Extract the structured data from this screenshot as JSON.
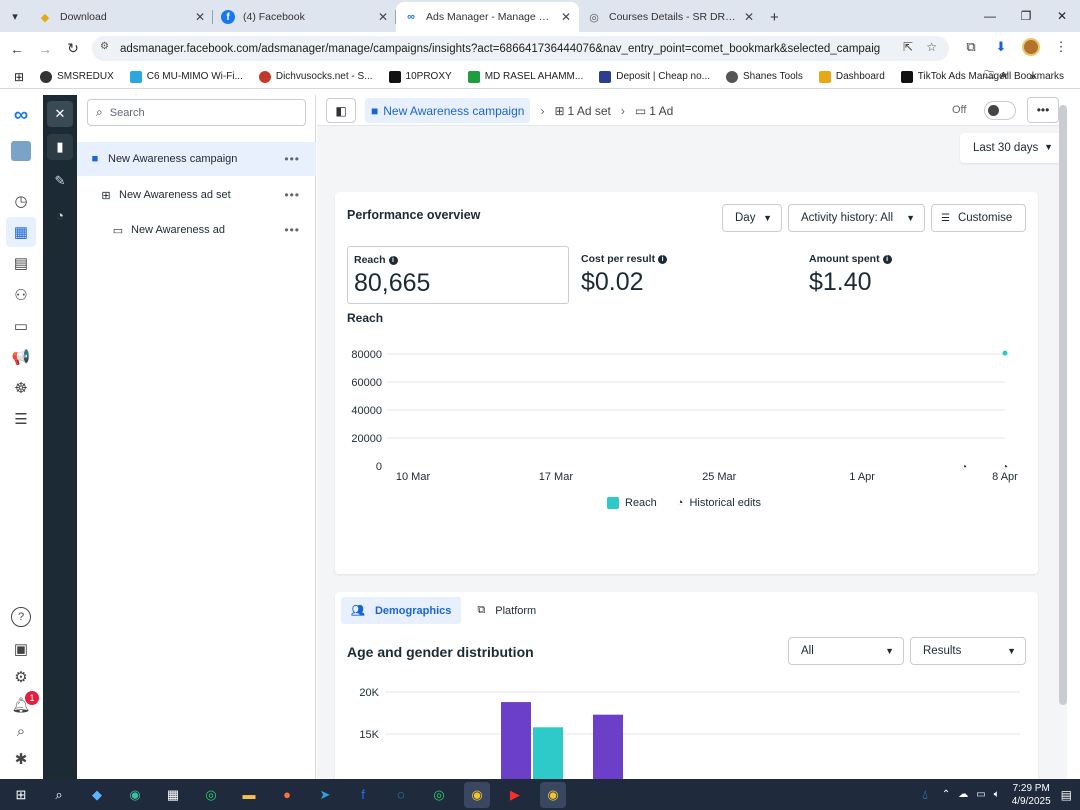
{
  "browser": {
    "tabs": [
      {
        "title": "Download",
        "icon": "download-favicon-icon",
        "active": false
      },
      {
        "title": "(4) Facebook",
        "icon": "facebook-favicon-icon",
        "active": false
      },
      {
        "title": "Ads Manager - Manage ads - C",
        "icon": "meta-favicon-icon",
        "active": true
      },
      {
        "title": "Courses Details - SR DREAM IT",
        "icon": "globe-favicon-icon",
        "active": false
      }
    ],
    "url": "adsmanager.facebook.com/adsmanager/manage/campaigns/insights?act=686641736444076&nav_entry_point=comet_bookmark&selected_campaign_ids=12...",
    "bookmarks": [
      {
        "label": "SMSREDUX",
        "color": "#333333"
      },
      {
        "label": "C6 MU-MIMO Wi-Fi...",
        "color": "#2aa7e0"
      },
      {
        "label": "Dichvusocks.net - S...",
        "color": "#c0392b"
      },
      {
        "label": "10PROXY",
        "color": "#111111"
      },
      {
        "label": "MD RASEL AHAMM...",
        "color": "#1e9e3e"
      },
      {
        "label": "Deposit | Cheap no...",
        "color": "#2c3e8f"
      },
      {
        "label": "Shanes Tools",
        "color": "#555555"
      },
      {
        "label": "Dashboard",
        "color": "#e6a817"
      },
      {
        "label": "TikTok Ads Manager",
        "color": "#111111"
      }
    ],
    "all_bookmarks": "All Bookmarks"
  },
  "tree": {
    "search_placeholder": "Search",
    "campaign": "New Awareness campaign",
    "adset": "New Awareness ad set",
    "ad": "New Awareness ad"
  },
  "breadcrumb": {
    "campaign": "New Awareness campaign",
    "adset": "1 Ad set",
    "ad": "1 Ad"
  },
  "toggle_label": "Off",
  "date_range": "Last 30 days",
  "performance": {
    "title": "Performance overview",
    "granularity": "Day",
    "activity": "Activity history: All",
    "customise": "Customise",
    "metrics": [
      {
        "label": "Reach",
        "value": "80,665"
      },
      {
        "label": "Cost per result",
        "value": "$0.02"
      },
      {
        "label": "Amount spent",
        "value": "$1.40"
      }
    ],
    "chart_title": "Reach",
    "legend_reach": "Reach",
    "legend_edits": "Historical edits"
  },
  "chart_data": [
    {
      "type": "line",
      "title": "Reach",
      "x": [
        "10 Mar",
        "17 Mar",
        "25 Mar",
        "1 Apr",
        "8 Apr"
      ],
      "y_ticks": [
        "80000",
        "60000",
        "40000",
        "20000",
        "0"
      ],
      "ylim": [
        0,
        80000
      ],
      "series": [
        {
          "name": "Reach",
          "points": [
            {
              "x": "8 Apr",
              "y": 80665
            }
          ],
          "color": "#2ec9c9"
        }
      ],
      "edit_markers": [
        "6 Apr",
        "8 Apr"
      ],
      "grid": true,
      "legend": "bottom"
    },
    {
      "type": "bar",
      "title": "Age and gender distribution",
      "y_ticks": [
        "20K",
        "15K"
      ],
      "series": [
        {
          "color": "#6b3fc7",
          "values": [
            18800,
            17300
          ]
        },
        {
          "color": "#2ec9c9",
          "values": [
            15800
          ]
        }
      ]
    }
  ],
  "demographics": {
    "tab_demographics": "Demographics",
    "tab_platform": "Platform",
    "title": "Age and gender distribution",
    "filter1": "All",
    "filter2": "Results"
  },
  "notifications_count": "1",
  "clock": {
    "time": "7:29 PM",
    "date": "4/9/2025"
  }
}
